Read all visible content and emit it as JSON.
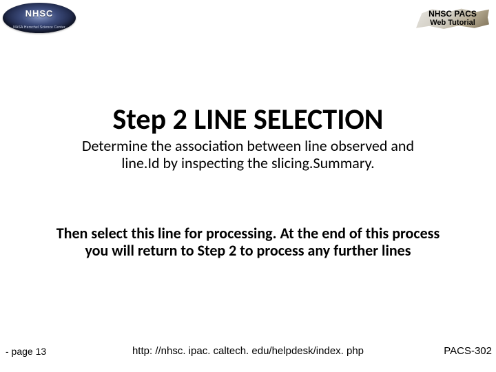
{
  "header": {
    "logo_name_acronym": "NHSC",
    "logo_sub": "NASA Herschel Science Center",
    "badge_line1": "NHSC PACS",
    "badge_line2": "Web Tutorial"
  },
  "content": {
    "title": "Step 2 LINE SELECTION",
    "paragraph1": "Determine the association between line observed and line.Id by inspecting the slicing.Summary.",
    "paragraph2": "Then select this line for  processing. At the end of this process you will return to Step 2 to process any further lines"
  },
  "footer": {
    "left": "- page 13",
    "center": "http: //nhsc. ipac. caltech. edu/helpdesk/index. php",
    "right": "PACS-302"
  }
}
